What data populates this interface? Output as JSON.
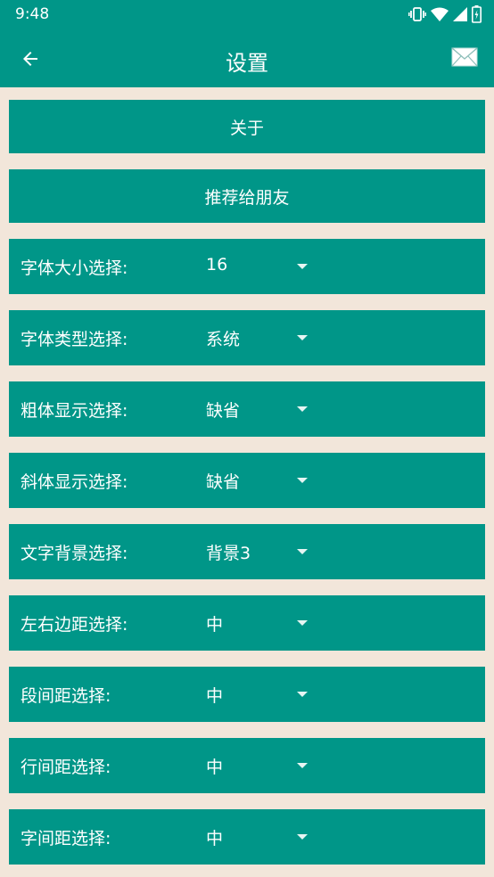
{
  "status_bar": {
    "time": "9:48",
    "icons": [
      "vibrate-icon",
      "wifi-icon",
      "signal-icon",
      "battery-icon"
    ]
  },
  "toolbar": {
    "title": "设置",
    "back_icon": "arrow-left-icon",
    "mail_icon": "mail-icon"
  },
  "buttons": {
    "about": "关于",
    "recommend": "推荐给朋友"
  },
  "settings": [
    {
      "label": "字体大小选择:",
      "value": "16"
    },
    {
      "label": "字体类型选择:",
      "value": "系统"
    },
    {
      "label": "粗体显示选择:",
      "value": "缺省"
    },
    {
      "label": "斜体显示选择:",
      "value": "缺省"
    },
    {
      "label": "文字背景选择:",
      "value": "背景3"
    },
    {
      "label": "左右边距选择:",
      "value": "中"
    },
    {
      "label": "段间距选择:",
      "value": "中"
    },
    {
      "label": "行间距选择:",
      "value": "中"
    },
    {
      "label": "字间距选择:",
      "value": "中"
    }
  ],
  "colors": {
    "primary": "#009688",
    "background": "#F2E6DA",
    "text_on_primary": "#FFFFFF"
  }
}
